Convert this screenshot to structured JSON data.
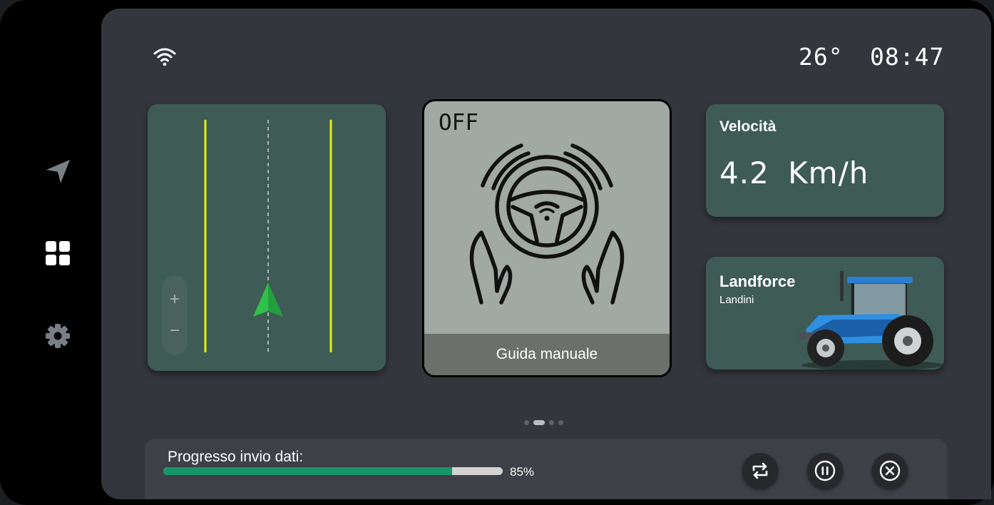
{
  "sidebar": {
    "items": [
      {
        "icon": "navigation-icon"
      },
      {
        "icon": "dashboard-icon",
        "active": true
      },
      {
        "icon": "gear-icon"
      }
    ]
  },
  "status_bar": {
    "wifi_icon": "wifi-icon",
    "temperature": "26°",
    "time": "08:47"
  },
  "map_card": {
    "zoom_in": "+",
    "zoom_out": "−",
    "icon": "direction-arrow-icon",
    "colors": {
      "lane_lines": "#e4f20a",
      "arrow": "#2fc14a"
    }
  },
  "steering_card": {
    "state": "OFF",
    "icon": "hands-on-steering-wheel-icon",
    "mode_label": "Guida manuale"
  },
  "speed_card": {
    "title": "Velocità",
    "value": "4.2 Km/h"
  },
  "vehicle_card": {
    "model": "Landforce",
    "brand": "Landini",
    "image": "blue-tractor-image"
  },
  "pager": {
    "count": 4,
    "active_index": 1
  },
  "upload": {
    "label": "Progresso invio dati:",
    "progress_fraction": 0.85,
    "percent_text": "85%",
    "buttons": [
      {
        "name": "retry-button",
        "icon": "repeat-icon"
      },
      {
        "name": "pause-button",
        "icon": "pause-circle-icon"
      },
      {
        "name": "cancel-button",
        "icon": "close-circle-icon"
      }
    ]
  },
  "colors": {
    "background": "#33363d",
    "card": "#3e5b55",
    "steering_card": "#a1a9a4",
    "progress": "#16956a"
  }
}
